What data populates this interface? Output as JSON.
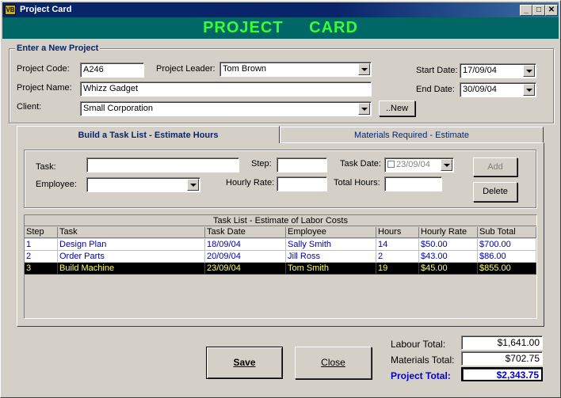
{
  "window": {
    "title": "Project Card",
    "banner_left": "PROJECT",
    "banner_right": "CARD"
  },
  "project": {
    "legend": "Enter a New Project",
    "code_label": "Project Code:",
    "code": "A246",
    "leader_label": "Project Leader:",
    "leader": "Tom Brown",
    "name_label": "Project Name:",
    "name": "Whizz Gadget",
    "client_label": "Client:",
    "client": "Small Corporation",
    "new_button": "..New",
    "start_label": "Start Date:",
    "start": "17/09/04",
    "end_label": "End Date:",
    "end": "30/09/04"
  },
  "tabs": [
    {
      "label": "Build a Task List - Estimate Hours",
      "active": true
    },
    {
      "label": "Materials Required - Estimate",
      "active": false
    }
  ],
  "task_form": {
    "task_label": "Task:",
    "task": "",
    "step_label": "Step:",
    "step": "",
    "date_label": "Task Date:",
    "date": "23/09/04",
    "employee_label": "Employee:",
    "employee": "",
    "rate_label": "Hourly Rate:",
    "rate": "",
    "hours_label": "Total Hours:",
    "hours": "",
    "add_button": "Add",
    "delete_button": "Delete"
  },
  "task_list": {
    "title": "Task List - Estimate of Labor Costs",
    "columns": [
      "Step",
      "Task",
      "Task Date",
      "Employee",
      "Hours",
      "Hourly Rate",
      "Sub Total"
    ],
    "rows": [
      [
        "1",
        "Design Plan",
        "18/09/04",
        "Sally Smith",
        "14",
        "$50.00",
        "$700.00"
      ],
      [
        "2",
        "Order Parts",
        "20/09/04",
        "Jill Ross",
        "2",
        "$43.00",
        "$86.00"
      ],
      [
        "3",
        "Build Machine",
        "23/09/04",
        "Tom Smith",
        "19",
        "$45.00",
        "$855.00"
      ]
    ],
    "selected_row": 2
  },
  "buttons": {
    "save": "Save",
    "close": "Close"
  },
  "totals": {
    "labour_label": "Labour Total:",
    "labour": "$1,641.00",
    "materials_label": "Materials Total:",
    "materials": "$702.75",
    "project_label": "Project Total:",
    "project": "$2,343.75"
  }
}
